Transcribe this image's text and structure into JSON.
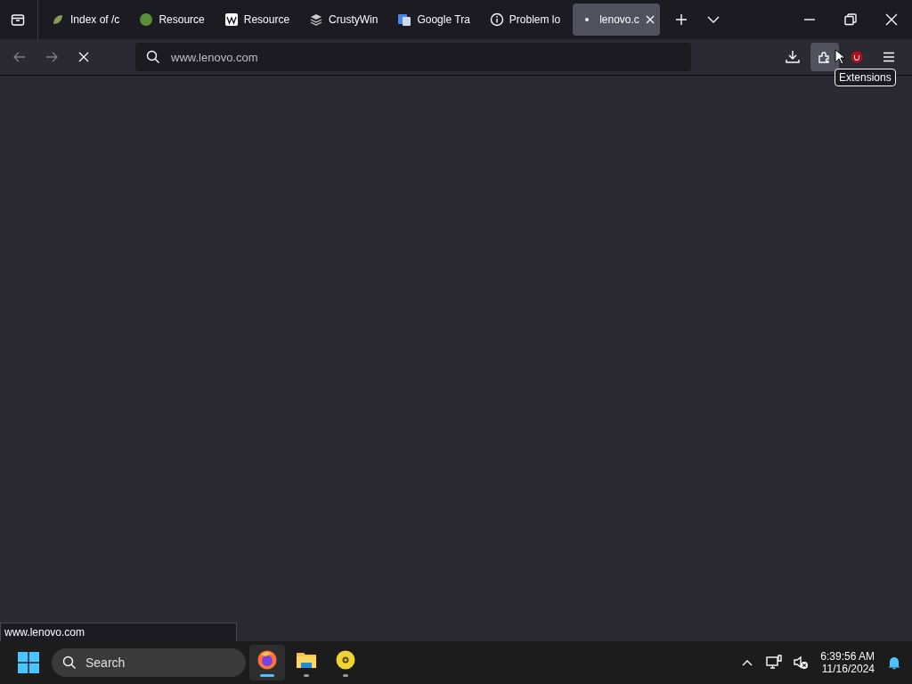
{
  "tabs": [
    {
      "label": "Index of /c",
      "kind": "leaf",
      "selected": false
    },
    {
      "label": "Resource",
      "kind": "circle",
      "selected": false
    },
    {
      "label": "Resource",
      "kind": "wiki",
      "selected": false
    },
    {
      "label": "CrustyWin",
      "kind": "stack",
      "selected": false
    },
    {
      "label": "Google Tra",
      "kind": "translate",
      "selected": false
    },
    {
      "label": "Problem lo",
      "kind": "info",
      "selected": false
    },
    {
      "label": "lenovo.c",
      "kind": "loading",
      "selected": true
    }
  ],
  "address_bar": {
    "value": "www.lenovo.com"
  },
  "tooltip": "Extensions",
  "status_text": "www.lenovo.com",
  "taskbar": {
    "search_placeholder": "Search",
    "apps": [
      {
        "kind": "browser",
        "selected": true
      },
      {
        "kind": "folder",
        "selected": false
      },
      {
        "kind": "disc",
        "selected": false
      }
    ],
    "time": "6:39:56 AM",
    "date": "11/16/2024"
  }
}
